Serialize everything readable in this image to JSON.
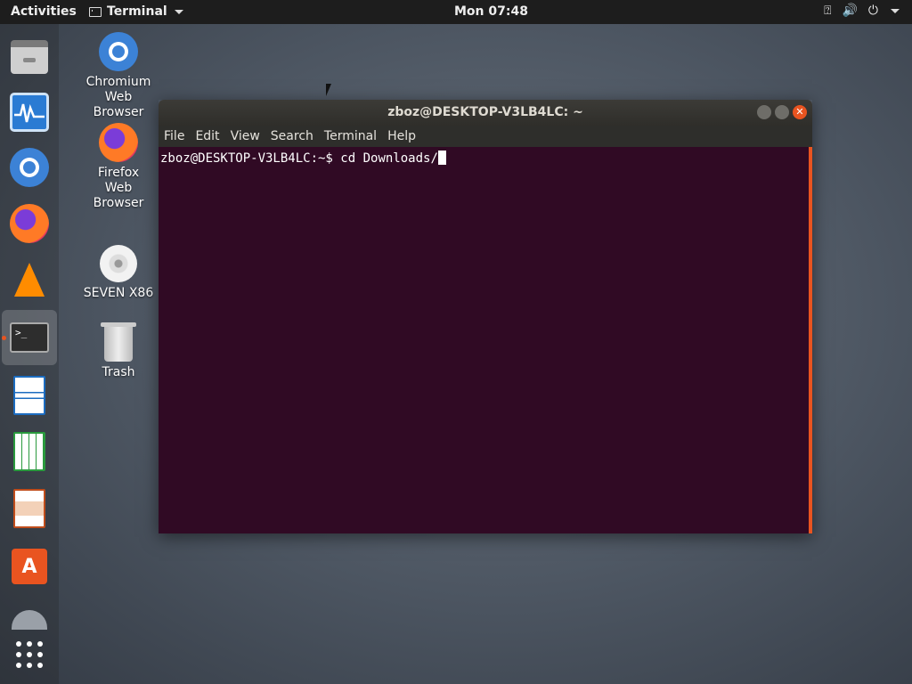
{
  "topbar": {
    "activities": "Activities",
    "app_menu": "Terminal",
    "clock": "Mon 07:48",
    "status_icons": [
      "network-icon",
      "volume-icon",
      "power-icon",
      "menu-caret-icon"
    ]
  },
  "dock": {
    "items": [
      {
        "name": "files",
        "icon": "file-cabinet-icon"
      },
      {
        "name": "system-monitor",
        "icon": "monitor-graph-icon"
      },
      {
        "name": "chromium",
        "icon": "chromium-icon"
      },
      {
        "name": "firefox",
        "icon": "firefox-icon"
      },
      {
        "name": "vlc",
        "icon": "vlc-cone-icon"
      },
      {
        "name": "terminal",
        "icon": "terminal-icon",
        "active": true
      },
      {
        "name": "libreoffice-writer",
        "icon": "writer-icon"
      },
      {
        "name": "libreoffice-calc",
        "icon": "calc-icon"
      },
      {
        "name": "libreoffice-impress",
        "icon": "impress-icon"
      },
      {
        "name": "software-center",
        "icon": "software-store-icon"
      },
      {
        "name": "software-updater",
        "icon": "updater-icon"
      },
      {
        "name": "show-applications",
        "icon": "app-grid-icon"
      }
    ]
  },
  "desktop": {
    "chromium": {
      "line1": "Chromium",
      "line2": "Web",
      "line3": "Browser"
    },
    "firefox": {
      "line1": "Firefox",
      "line2": "Web",
      "line3": "Browser"
    },
    "cd": {
      "label": "SEVEN X86"
    },
    "trash": {
      "label": "Trash"
    }
  },
  "terminal": {
    "title": "zboz@DESKTOP-V3LB4LC: ~",
    "menu": [
      "File",
      "Edit",
      "View",
      "Search",
      "Terminal",
      "Help"
    ],
    "prompt": "zboz@DESKTOP-V3LB4LC:~$ ",
    "command": "cd Downloads/",
    "colors": {
      "background": "#300a24",
      "accent": "#e95420"
    }
  }
}
